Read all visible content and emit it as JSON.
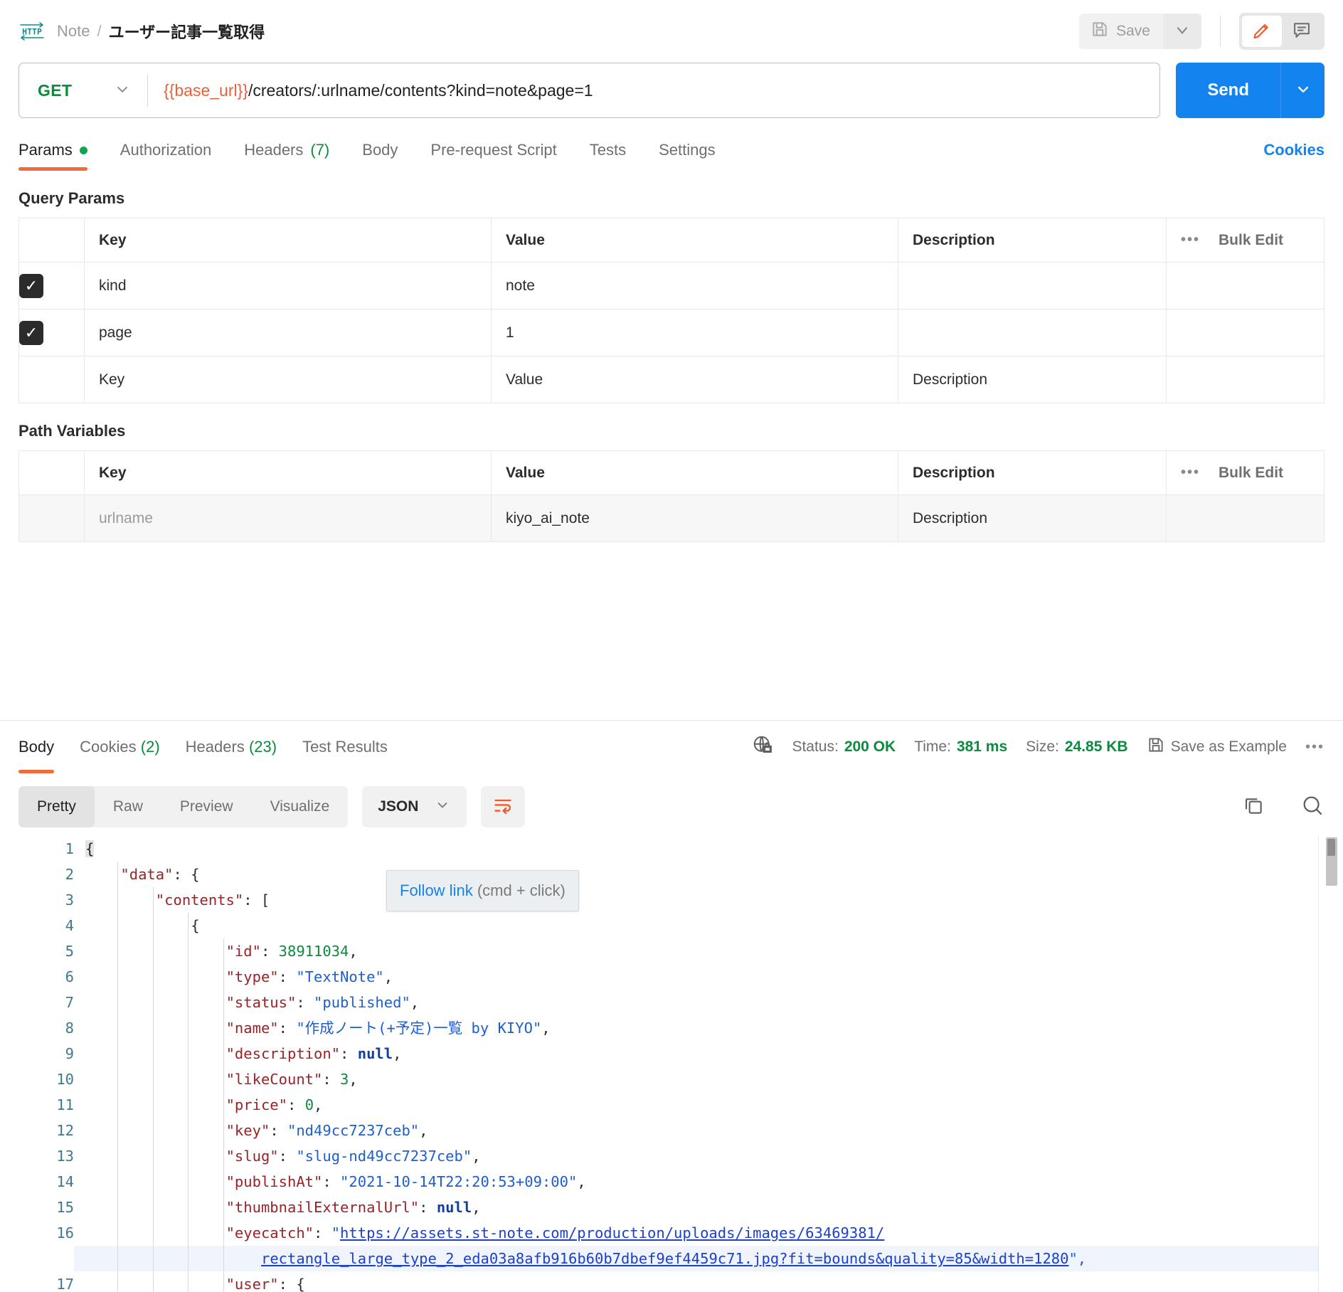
{
  "header": {
    "protocol_icon": "http-icon",
    "breadcrumb_collection": "Note",
    "breadcrumb_separator": "/",
    "breadcrumb_current": "ユーザー記事一覧取得",
    "save_label": "Save",
    "save_icon": "floppy-disk-icon",
    "save_caret_icon": "chevron-down-icon",
    "edit_icon": "pencil-icon",
    "comment_icon": "comment-icon"
  },
  "url_bar": {
    "method": "GET",
    "method_caret_icon": "chevron-down-icon",
    "url_variable": "{{base_url}}",
    "url_path": "/creators/:urlname/contents?kind=note&page=1",
    "send_label": "Send",
    "send_caret_icon": "chevron-down-icon"
  },
  "request_tabs": [
    {
      "label": "Params",
      "badge": "",
      "dot": true,
      "active": true
    },
    {
      "label": "Authorization",
      "badge": "",
      "dot": false,
      "active": false
    },
    {
      "label": "Headers",
      "badge": "(7)",
      "dot": false,
      "active": false
    },
    {
      "label": "Body",
      "badge": "",
      "dot": false,
      "active": false
    },
    {
      "label": "Pre-request Script",
      "badge": "",
      "dot": false,
      "active": false
    },
    {
      "label": "Tests",
      "badge": "",
      "dot": false,
      "active": false
    },
    {
      "label": "Settings",
      "badge": "",
      "dot": false,
      "active": false
    }
  ],
  "cookies_link": "Cookies",
  "query_params": {
    "title": "Query Params",
    "columns": [
      "Key",
      "Value",
      "Description"
    ],
    "bulk_edit_label": "Bulk Edit",
    "more_icon": "ellipsis-icon",
    "rows": [
      {
        "checked": true,
        "key": "kind",
        "value": "note",
        "description": ""
      },
      {
        "checked": true,
        "key": "page",
        "value": "1",
        "description": ""
      }
    ],
    "placeholder_row": {
      "key": "Key",
      "value": "Value",
      "description": "Description"
    }
  },
  "path_variables": {
    "title": "Path Variables",
    "columns": [
      "Key",
      "Value",
      "Description"
    ],
    "bulk_edit_label": "Bulk Edit",
    "more_icon": "ellipsis-icon",
    "rows": [
      {
        "key": "urlname",
        "value": "kiyo_ai_note",
        "description": "Description"
      }
    ]
  },
  "response": {
    "tabs": [
      {
        "label": "Body",
        "badge": "",
        "active": true
      },
      {
        "label": "Cookies",
        "badge": "(2)",
        "active": false
      },
      {
        "label": "Headers",
        "badge": "(23)",
        "active": false
      },
      {
        "label": "Test Results",
        "badge": "",
        "active": false
      }
    ],
    "shield_icon": "globe-lock-icon",
    "status_label": "Status:",
    "status_value": "200 OK",
    "time_label": "Time:",
    "time_value": "381 ms",
    "size_label": "Size:",
    "size_value": "24.85 KB",
    "save_example_icon": "floppy-disk-icon",
    "save_example_label": "Save as Example",
    "more_icon": "ellipsis-icon"
  },
  "viewer": {
    "modes": [
      {
        "label": "Pretty",
        "active": true
      },
      {
        "label": "Raw",
        "active": false
      },
      {
        "label": "Preview",
        "active": false
      },
      {
        "label": "Visualize",
        "active": false
      }
    ],
    "format": "JSON",
    "format_caret_icon": "chevron-down-icon",
    "wrap_icon": "word-wrap-icon",
    "copy_icon": "copy-icon",
    "search_icon": "search-icon"
  },
  "tooltip": {
    "link_text": "Follow link",
    "hint_text": " (cmd + click)"
  },
  "body_lines": [
    {
      "num": "1",
      "indent": 0,
      "tokens": [
        {
          "t": "{",
          "c": "sel-brace"
        }
      ]
    },
    {
      "num": "2",
      "indent": 1,
      "tokens": [
        {
          "t": "\"data\"",
          "c": "k"
        },
        {
          "t": ": {",
          "c": "p"
        }
      ]
    },
    {
      "num": "3",
      "indent": 2,
      "tokens": [
        {
          "t": "\"contents\"",
          "c": "k"
        },
        {
          "t": ": [",
          "c": "p"
        }
      ]
    },
    {
      "num": "4",
      "indent": 3,
      "tokens": [
        {
          "t": "{",
          "c": "p"
        }
      ]
    },
    {
      "num": "5",
      "indent": 4,
      "tokens": [
        {
          "t": "\"id\"",
          "c": "k"
        },
        {
          "t": ": ",
          "c": "p"
        },
        {
          "t": "38911034",
          "c": "n"
        },
        {
          "t": ",",
          "c": "p"
        }
      ]
    },
    {
      "num": "6",
      "indent": 4,
      "tokens": [
        {
          "t": "\"type\"",
          "c": "k"
        },
        {
          "t": ": ",
          "c": "p"
        },
        {
          "t": "\"TextNote\"",
          "c": "s"
        },
        {
          "t": ",",
          "c": "p"
        }
      ]
    },
    {
      "num": "7",
      "indent": 4,
      "tokens": [
        {
          "t": "\"status\"",
          "c": "k"
        },
        {
          "t": ": ",
          "c": "p"
        },
        {
          "t": "\"published\"",
          "c": "s"
        },
        {
          "t": ",",
          "c": "p"
        }
      ]
    },
    {
      "num": "8",
      "indent": 4,
      "tokens": [
        {
          "t": "\"name\"",
          "c": "k"
        },
        {
          "t": ": ",
          "c": "p"
        },
        {
          "t": "\"作成ノート(+予定)一覧 by KIYO\"",
          "c": "s"
        },
        {
          "t": ",",
          "c": "p"
        }
      ]
    },
    {
      "num": "9",
      "indent": 4,
      "tokens": [
        {
          "t": "\"description\"",
          "c": "k"
        },
        {
          "t": ": ",
          "c": "p"
        },
        {
          "t": "null",
          "c": "nul"
        },
        {
          "t": ",",
          "c": "p"
        }
      ]
    },
    {
      "num": "10",
      "indent": 4,
      "tokens": [
        {
          "t": "\"likeCount\"",
          "c": "k"
        },
        {
          "t": ": ",
          "c": "p"
        },
        {
          "t": "3",
          "c": "n"
        },
        {
          "t": ",",
          "c": "p"
        }
      ]
    },
    {
      "num": "11",
      "indent": 4,
      "tokens": [
        {
          "t": "\"price\"",
          "c": "k"
        },
        {
          "t": ": ",
          "c": "p"
        },
        {
          "t": "0",
          "c": "n"
        },
        {
          "t": ",",
          "c": "p"
        }
      ]
    },
    {
      "num": "12",
      "indent": 4,
      "tokens": [
        {
          "t": "\"key\"",
          "c": "k"
        },
        {
          "t": ": ",
          "c": "p"
        },
        {
          "t": "\"nd49cc7237ceb\"",
          "c": "s"
        },
        {
          "t": ",",
          "c": "p"
        }
      ]
    },
    {
      "num": "13",
      "indent": 4,
      "tokens": [
        {
          "t": "\"slug\"",
          "c": "k"
        },
        {
          "t": ": ",
          "c": "p"
        },
        {
          "t": "\"slug-nd49cc7237ceb\"",
          "c": "s"
        },
        {
          "t": ",",
          "c": "p"
        }
      ]
    },
    {
      "num": "14",
      "indent": 4,
      "tokens": [
        {
          "t": "\"publishAt\"",
          "c": "k"
        },
        {
          "t": ": ",
          "c": "p"
        },
        {
          "t": "\"2021-10-14T22:20:53+09:00\"",
          "c": "s"
        },
        {
          "t": ",",
          "c": "p"
        }
      ]
    },
    {
      "num": "15",
      "indent": 4,
      "tokens": [
        {
          "t": "\"thumbnailExternalUrl\"",
          "c": "k"
        },
        {
          "t": ": ",
          "c": "p"
        },
        {
          "t": "null",
          "c": "nul"
        },
        {
          "t": ",",
          "c": "p"
        }
      ]
    },
    {
      "num": "16",
      "indent": 4,
      "tokens": [
        {
          "t": "\"eyecatch\"",
          "c": "k"
        },
        {
          "t": ": ",
          "c": "p"
        },
        {
          "t": "\"",
          "c": "s"
        },
        {
          "t": "https://assets.st-note.com/production/uploads/images/63469381/",
          "c": "lnk"
        }
      ]
    },
    {
      "num": "",
      "indent": 5,
      "tokens": [
        {
          "t": "rectangle_large_type_2_eda03a8afb916b60b7dbef9ef4459c71.jpg?fit=bounds&quality=85&width=1280",
          "c": "lnk"
        },
        {
          "t": "\",",
          "c": "s"
        }
      ]
    },
    {
      "num": "17",
      "indent": 4,
      "tokens": [
        {
          "t": "\"user\"",
          "c": "k"
        },
        {
          "t": ": {",
          "c": "p"
        }
      ]
    }
  ]
}
